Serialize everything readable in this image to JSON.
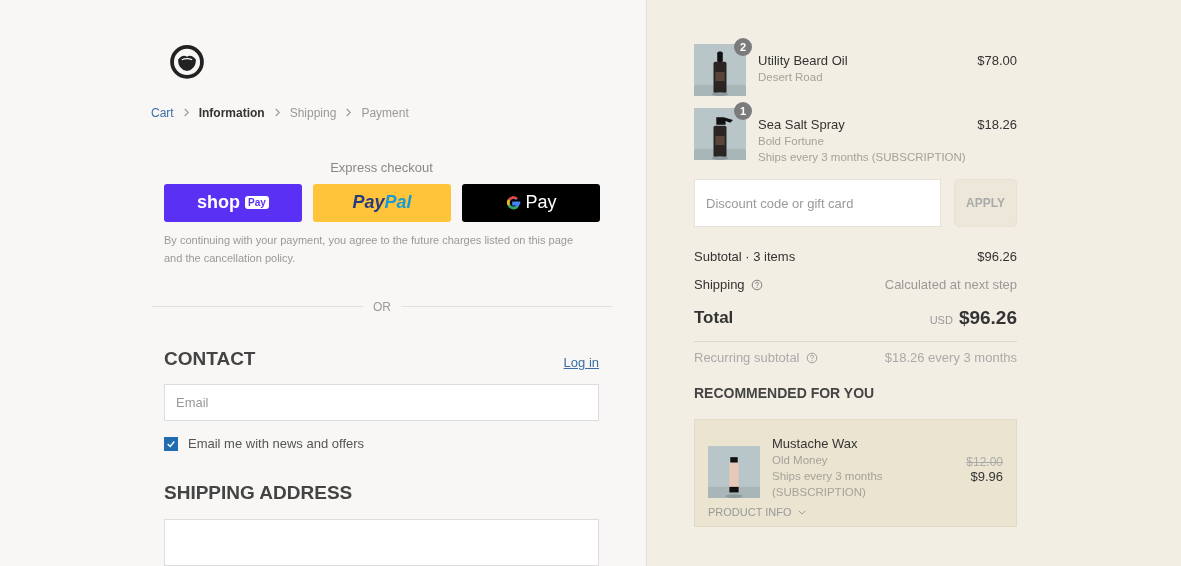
{
  "breadcrumb": [
    {
      "label": "Cart",
      "kind": "link"
    },
    {
      "label": "Information",
      "kind": "current"
    },
    {
      "label": "Shipping",
      "kind": "upcoming"
    },
    {
      "label": "Payment",
      "kind": "upcoming"
    }
  ],
  "express_checkout": {
    "title": "Express checkout",
    "buttons": [
      {
        "kind": "shop_pay",
        "label": "shop",
        "badge": "Pay"
      },
      {
        "kind": "paypal",
        "label": "Pay",
        "label_2": "Pal"
      },
      {
        "kind": "google_pay",
        "label": "Pay"
      }
    ],
    "notice": "By continuing with your payment, you agree to the future charges listed on this page and the cancellation policy."
  },
  "divider": "OR",
  "contact": {
    "heading": "CONTACT",
    "login_link": "Log in",
    "email": {
      "placeholder": "Email"
    },
    "newsletter": {
      "label": "Email me with news and offers",
      "checked": true
    }
  },
  "shipping_address": {
    "heading": "SHIPPING ADDRESS"
  },
  "cart_items": [
    {
      "name": "Utility Beard Oil",
      "variant": "Desert Road",
      "price": "$78.00",
      "quantity": "2",
      "kind": "dropper"
    },
    {
      "name": "Sea Salt Spray",
      "variant": "Bold Fortune",
      "note": "Ships every 3 months (SUBSCRIPTION)",
      "price": "$18.26",
      "quantity": "1",
      "kind": "spray"
    }
  ],
  "discount": {
    "placeholder": "Discount code or gift card",
    "button": "APPLY",
    "disabled": true
  },
  "summary": {
    "subtotal": {
      "label": "Subtotal · 3 items",
      "value": "$96.26"
    },
    "shipping": {
      "label": "Shipping",
      "value": "Calculated at next step"
    },
    "total": {
      "label": "Total",
      "currency": "USD",
      "value": "$96.26"
    },
    "recurring": {
      "label": "Recurring subtotal",
      "value": "$18.26 every 3 months"
    }
  },
  "recommended": {
    "heading": "RECOMMENDED FOR YOU",
    "items": [
      {
        "name": "Mustache Wax",
        "variant": "Old Money",
        "note": "Ships every 3 months (SUBSCRIPTION)",
        "old_price": "$12.00",
        "price": "$9.96",
        "info_link": "PRODUCT INFO"
      }
    ]
  }
}
